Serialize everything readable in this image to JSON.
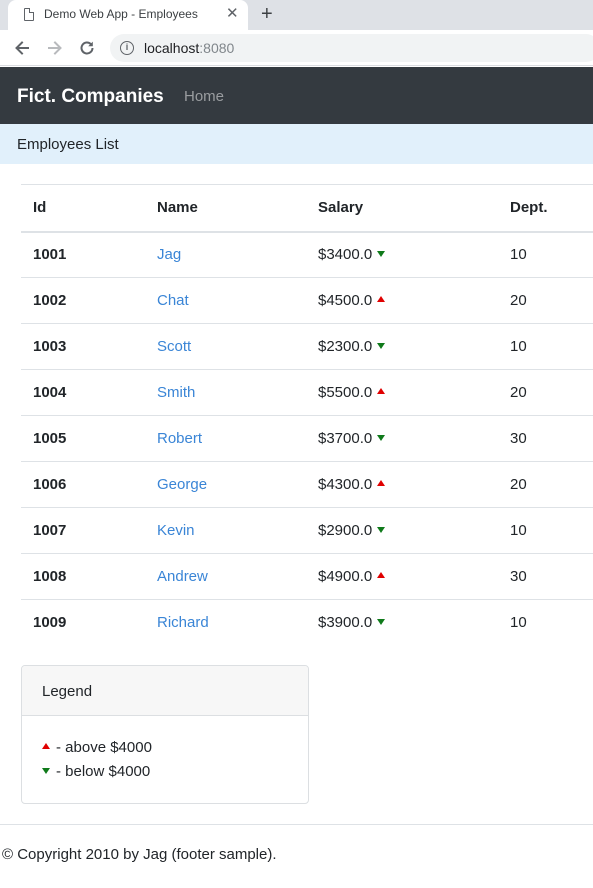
{
  "browser": {
    "tab_title": "Demo Web App - Employees",
    "tab_close": "✕",
    "new_tab": "+",
    "url_host": "localhost",
    "url_port": ":8080",
    "info_glyph": "i"
  },
  "navbar": {
    "brand": "Fict. Companies",
    "home_link": "Home"
  },
  "subheader": {
    "text": "Employees List"
  },
  "table": {
    "columns": [
      "Id",
      "Name",
      "Salary",
      "Dept."
    ],
    "rows": [
      {
        "id": "1001",
        "name": "Jag",
        "salary": "$3400.0",
        "trend": "down",
        "dept": "10"
      },
      {
        "id": "1002",
        "name": "Chat",
        "salary": "$4500.0",
        "trend": "up",
        "dept": "20"
      },
      {
        "id": "1003",
        "name": "Scott",
        "salary": "$2300.0",
        "trend": "down",
        "dept": "10"
      },
      {
        "id": "1004",
        "name": "Smith",
        "salary": "$5500.0",
        "trend": "up",
        "dept": "20"
      },
      {
        "id": "1005",
        "name": "Robert",
        "salary": "$3700.0",
        "trend": "down",
        "dept": "30"
      },
      {
        "id": "1006",
        "name": "George",
        "salary": "$4300.0",
        "trend": "up",
        "dept": "20"
      },
      {
        "id": "1007",
        "name": "Kevin",
        "salary": "$2900.0",
        "trend": "down",
        "dept": "10"
      },
      {
        "id": "1008",
        "name": "Andrew",
        "salary": "$4900.0",
        "trend": "up",
        "dept": "30"
      },
      {
        "id": "1009",
        "name": "Richard",
        "salary": "$3900.0",
        "trend": "down",
        "dept": "10"
      }
    ]
  },
  "legend": {
    "title": "Legend",
    "above": "- above $4000",
    "below": "- below $4000"
  },
  "footer": {
    "text": "© Copyright 2010 by Jag (footer sample)."
  },
  "colors": {
    "navbar_bg": "#343a40",
    "subheader_bg": "#e1f0fb",
    "link": "#3a85d6",
    "up_arrow": "#e00000",
    "down_arrow": "#0f7a1a"
  },
  "icons": {
    "tab": "page-icon",
    "back": "arrow-left-icon",
    "forward": "arrow-right-icon",
    "reload": "reload-icon",
    "site_info": "info-icon",
    "up": "triangle-up-icon",
    "down": "triangle-down-icon"
  }
}
